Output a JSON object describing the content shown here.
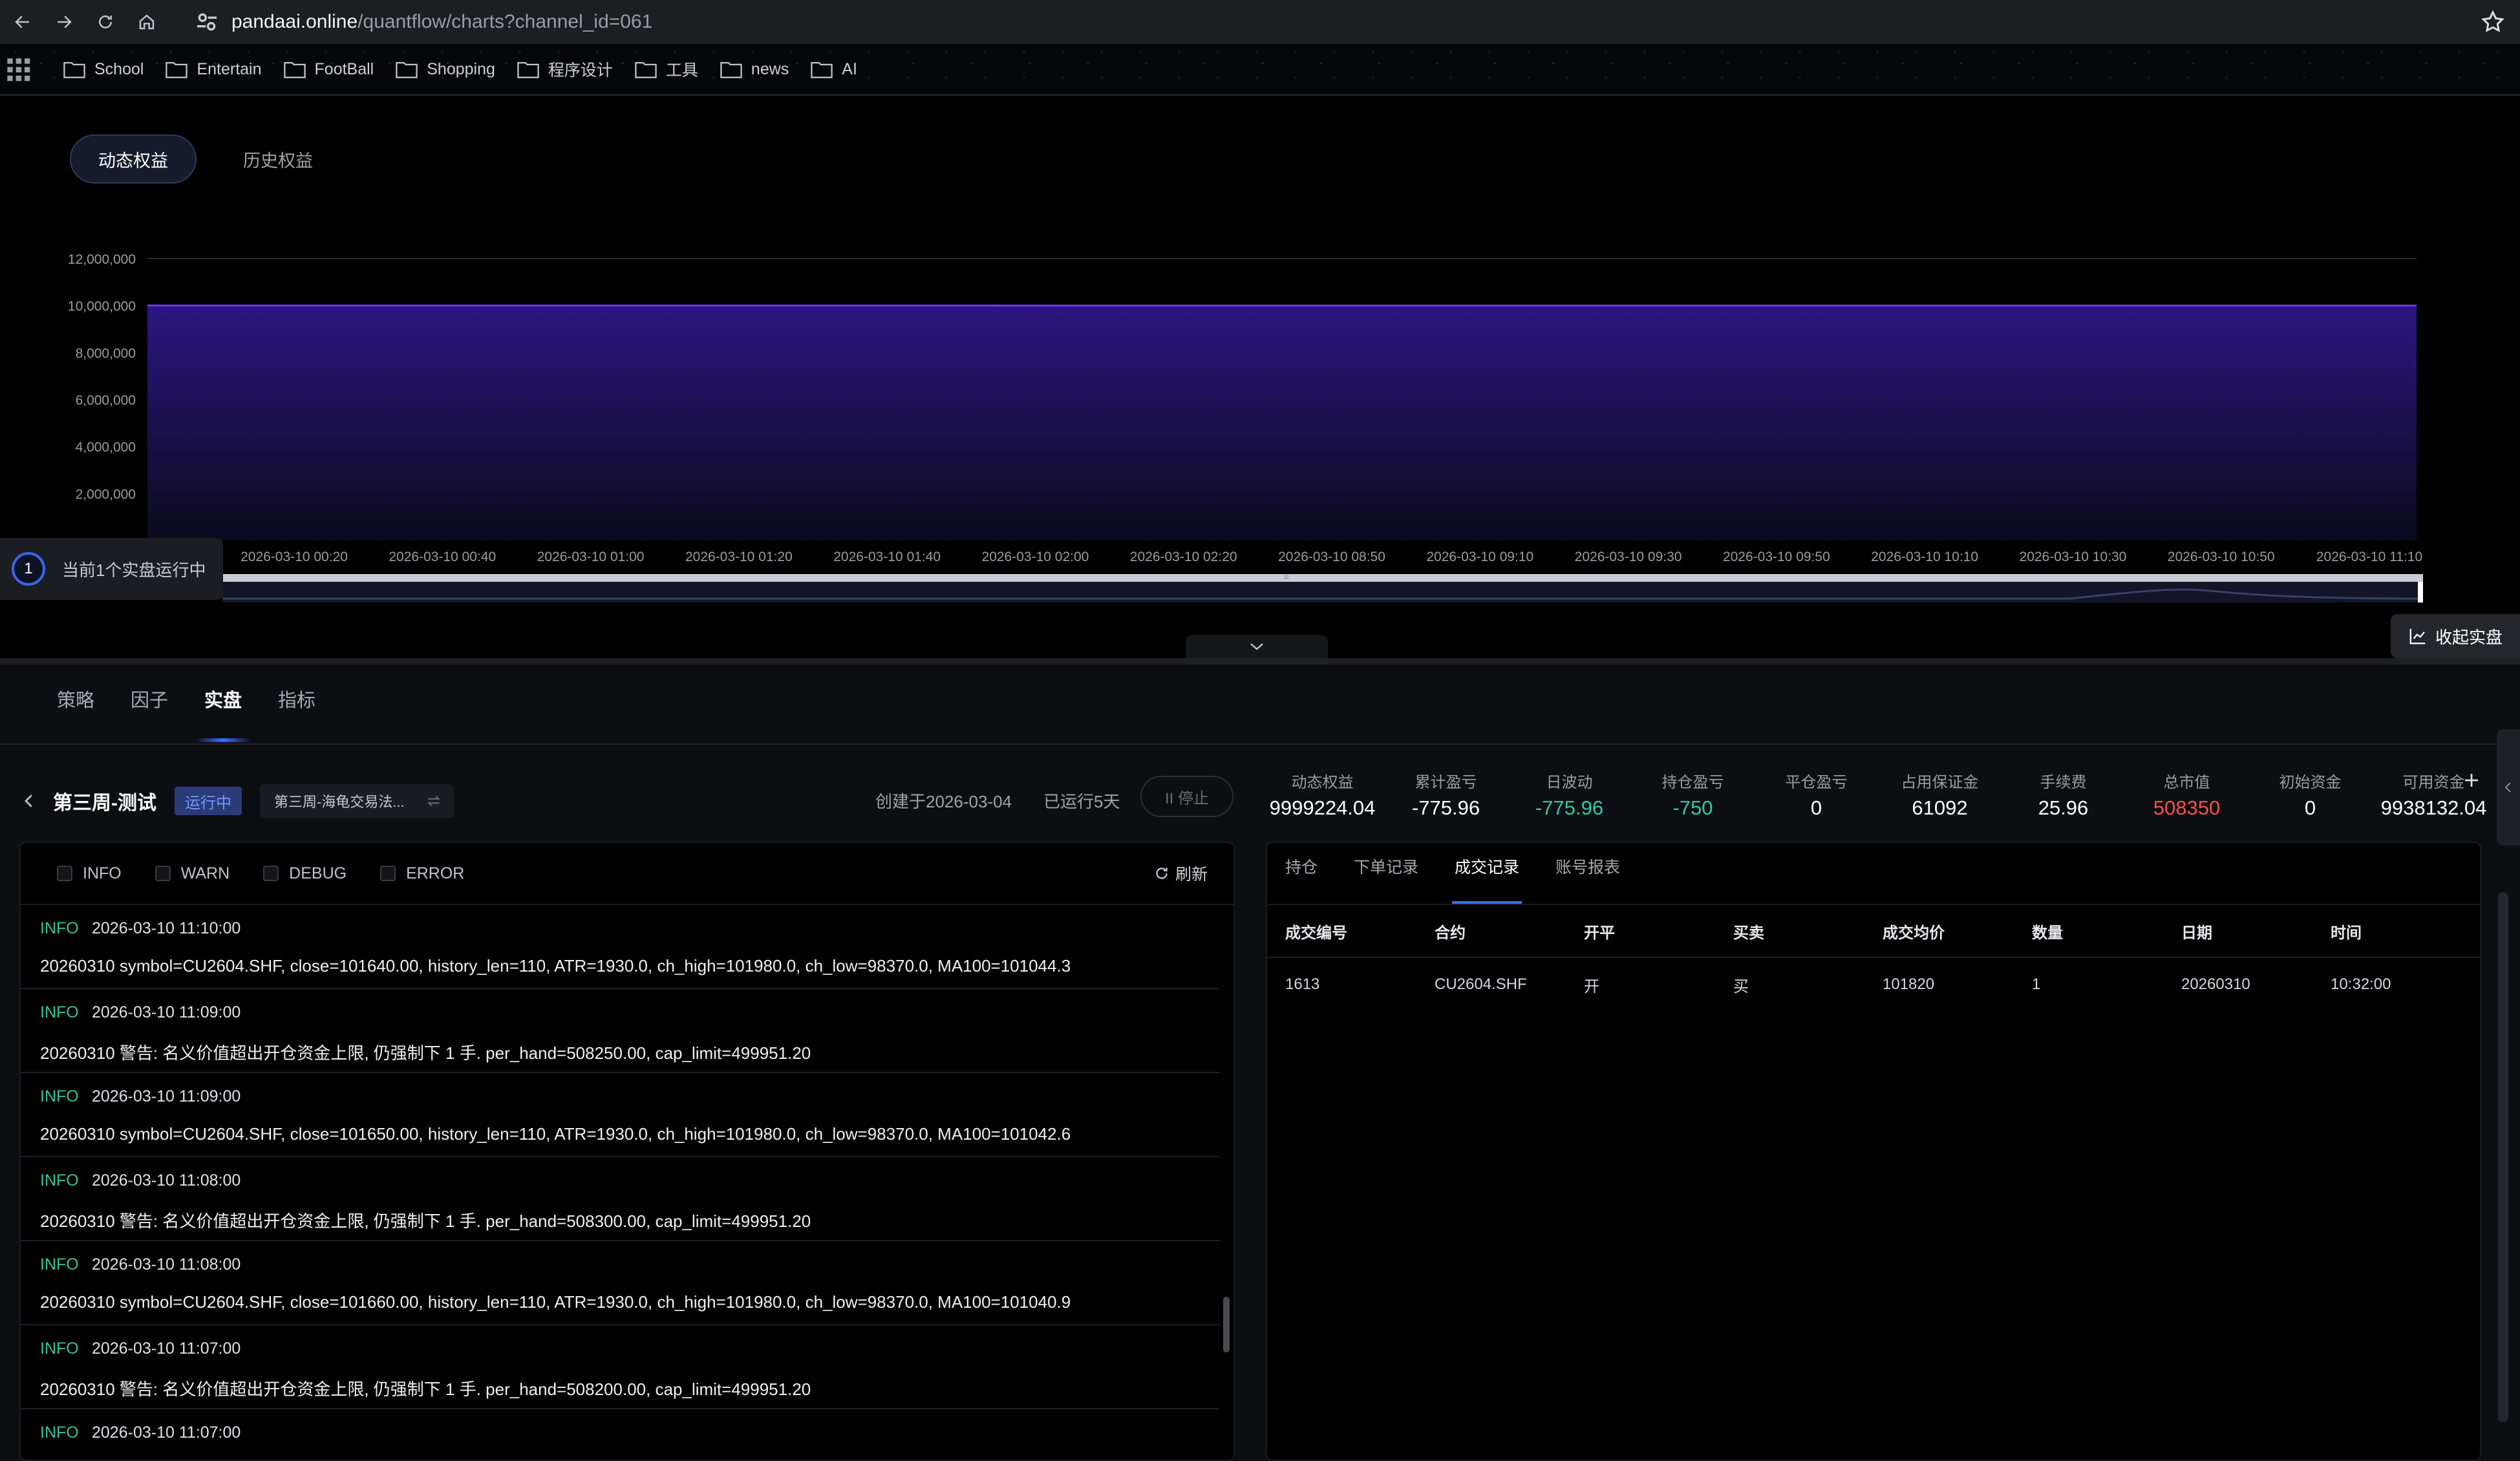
{
  "browser": {
    "url_host": "pandaai.online",
    "url_path": "/quantflow/charts?channel_id=061"
  },
  "bookmarks": [
    "School",
    "Entertain",
    "FootBall",
    "Shopping",
    "程序设计",
    "工具",
    "news",
    "AI"
  ],
  "equity_tabs": [
    "动态权益",
    "历史权益"
  ],
  "chart_data": {
    "type": "area",
    "y_ticks": [
      "12,000,000",
      "10,000,000",
      "8,000,000",
      "6,000,000",
      "4,000,000",
      "2,000,000"
    ],
    "ylim": [
      0,
      12000000
    ],
    "x_ticks": [
      "2026-03-10 00:20",
      "2026-03-10 00:40",
      "2026-03-10 01:00",
      "2026-03-10 01:20",
      "2026-03-10 01:40",
      "2026-03-10 02:00",
      "2026-03-10 02:20",
      "2026-03-10 08:50",
      "2026-03-10 09:10",
      "2026-03-10 09:30",
      "2026-03-10 09:50",
      "2026-03-10 10:10",
      "2026-03-10 10:30",
      "2026-03-10 10:50",
      "2026-03-10 11:10"
    ],
    "series": [
      {
        "values": [
          9999800,
          9999700,
          9999650,
          9999600,
          9999500,
          9999450,
          9999400,
          9999350,
          9999300,
          9999280,
          9999260,
          9999250,
          9999240,
          9999230,
          9999224.04
        ]
      }
    ],
    "line_color": "#6a3cf0",
    "grid": true
  },
  "runner": {
    "count": "1",
    "text": "当前1个实盘运行中"
  },
  "fold_button": "收起实盘",
  "main_tabs": [
    "策略",
    "因子",
    "实盘",
    "指标"
  ],
  "strategy": {
    "name": "第三周-测试",
    "status": "运行中",
    "selector": "第三周-海龟交易法...",
    "created": "创建于2026-03-04",
    "running": "已运行5天",
    "stop": "II 停止"
  },
  "metrics": [
    {
      "label": "动态权益",
      "value": "9999224.04",
      "color": "#ffffff"
    },
    {
      "label": "累计盈亏",
      "value": "-775.96",
      "color": "#ffffff"
    },
    {
      "label": "日波动",
      "value": "-775.96",
      "color": "#36c7a4"
    },
    {
      "label": "持仓盈亏",
      "value": "-750",
      "color": "#36c7a4"
    },
    {
      "label": "平仓盈亏",
      "value": "0",
      "color": "#ffffff"
    },
    {
      "label": "占用保证金",
      "value": "61092",
      "color": "#ffffff"
    },
    {
      "label": "手续费",
      "value": "25.96",
      "color": "#ffffff"
    },
    {
      "label": "总市值",
      "value": "508350",
      "color": "#ff4d4f"
    },
    {
      "label": "初始资金",
      "value": "0",
      "color": "#ffffff"
    },
    {
      "label": "可用资金",
      "value": "9938132.04",
      "color": "#ffffff"
    }
  ],
  "log": {
    "filters": [
      "INFO",
      "WARN",
      "DEBUG",
      "ERROR"
    ],
    "refresh": "刷新",
    "entries": [
      {
        "level": "INFO",
        "time": "2026-03-10 11:10:00",
        "msg": "20260310 symbol=CU2604.SHF, close=101640.00, history_len=110, ATR=1930.0, ch_high=101980.0, ch_low=98370.0, MA100=101044.3"
      },
      {
        "level": "INFO",
        "time": "2026-03-10 11:09:00",
        "msg": "20260310 警告: 名义价值超出开仓资金上限, 仍强制下 1 手. per_hand=508250.00, cap_limit=499951.20"
      },
      {
        "level": "INFO",
        "time": "2026-03-10 11:09:00",
        "msg": "20260310 symbol=CU2604.SHF, close=101650.00, history_len=110, ATR=1930.0, ch_high=101980.0, ch_low=98370.0, MA100=101042.6"
      },
      {
        "level": "INFO",
        "time": "2026-03-10 11:08:00",
        "msg": "20260310 警告: 名义价值超出开仓资金上限, 仍强制下 1 手. per_hand=508300.00, cap_limit=499951.20"
      },
      {
        "level": "INFO",
        "time": "2026-03-10 11:08:00",
        "msg": "20260310 symbol=CU2604.SHF, close=101660.00, history_len=110, ATR=1930.0, ch_high=101980.0, ch_low=98370.0, MA100=101040.9"
      },
      {
        "level": "INFO",
        "time": "2026-03-10 11:07:00",
        "msg": "20260310 警告: 名义价值超出开仓资金上限, 仍强制下 1 手. per_hand=508200.00, cap_limit=499951.20"
      },
      {
        "level": "INFO",
        "time": "2026-03-10 11:07:00",
        "msg": ""
      }
    ]
  },
  "trade": {
    "tabs": [
      "持仓",
      "下单记录",
      "成交记录",
      "账号报表"
    ],
    "active_tab": 2,
    "columns": [
      "成交编号",
      "合约",
      "开平",
      "买卖",
      "成交均价",
      "数量",
      "日期",
      "时间"
    ],
    "rows": [
      [
        "1613",
        "CU2604.SHF",
        "开",
        "买",
        "101820",
        "1",
        "20260310",
        "10:32:00"
      ]
    ]
  }
}
